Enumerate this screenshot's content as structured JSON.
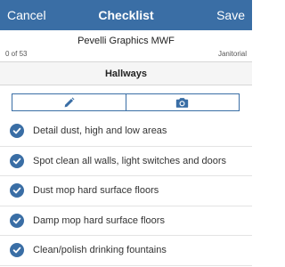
{
  "navbar": {
    "cancel_label": "Cancel",
    "title": "Checklist",
    "save_label": "Save",
    "bg_color": "#3a6ea5"
  },
  "header": {
    "location_name": "Pevelli Graphics MWF",
    "progress_text": "0 of 53",
    "category": "Janitorial"
  },
  "section": {
    "title": "Hallways"
  },
  "toolbar": {
    "edit_icon": "pencil-icon",
    "photo_icon": "camera-icon"
  },
  "checklist": {
    "check_icon": "checkmark-circle-icon",
    "items": [
      {
        "label": "Detail dust, high and low areas",
        "checked": true
      },
      {
        "label": "Spot clean all walls, light switches and doors",
        "checked": true
      },
      {
        "label": "Dust mop hard surface floors",
        "checked": true
      },
      {
        "label": "Damp mop hard surface floors",
        "checked": true
      },
      {
        "label": "Clean/polish drinking fountains",
        "checked": true
      }
    ]
  }
}
